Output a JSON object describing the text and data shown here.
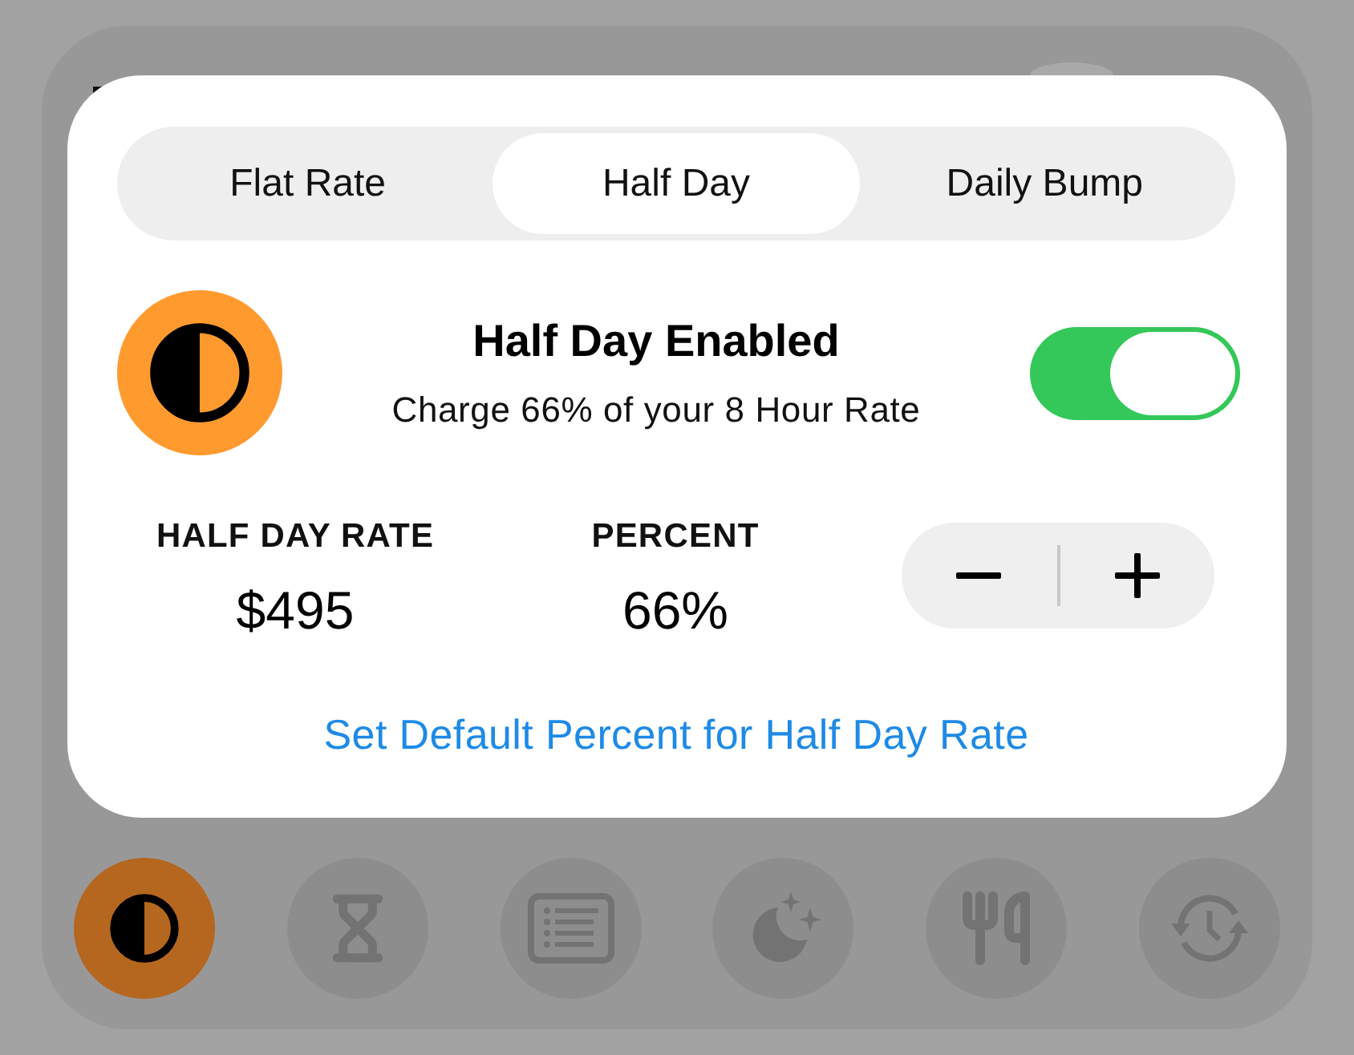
{
  "tabs": [
    {
      "label": "Flat Rate",
      "selected": false
    },
    {
      "label": "Half Day",
      "selected": true
    },
    {
      "label": "Daily Bump",
      "selected": false
    }
  ],
  "feature": {
    "title": "Half Day Enabled",
    "subtitle": "Charge 66% of your 8 Hour Rate",
    "on": true
  },
  "stats": [
    {
      "label": "HALF DAY RATE",
      "value": "$495"
    },
    {
      "label": "PERCENT",
      "value": "66%"
    }
  ],
  "link": "Set Default Percent for Half Day Rate",
  "bottom_bar": {
    "items": [
      {
        "selected": true
      },
      {
        "selected": false
      },
      {
        "selected": false
      },
      {
        "selected": false
      },
      {
        "selected": false
      },
      {
        "selected": false
      }
    ]
  }
}
